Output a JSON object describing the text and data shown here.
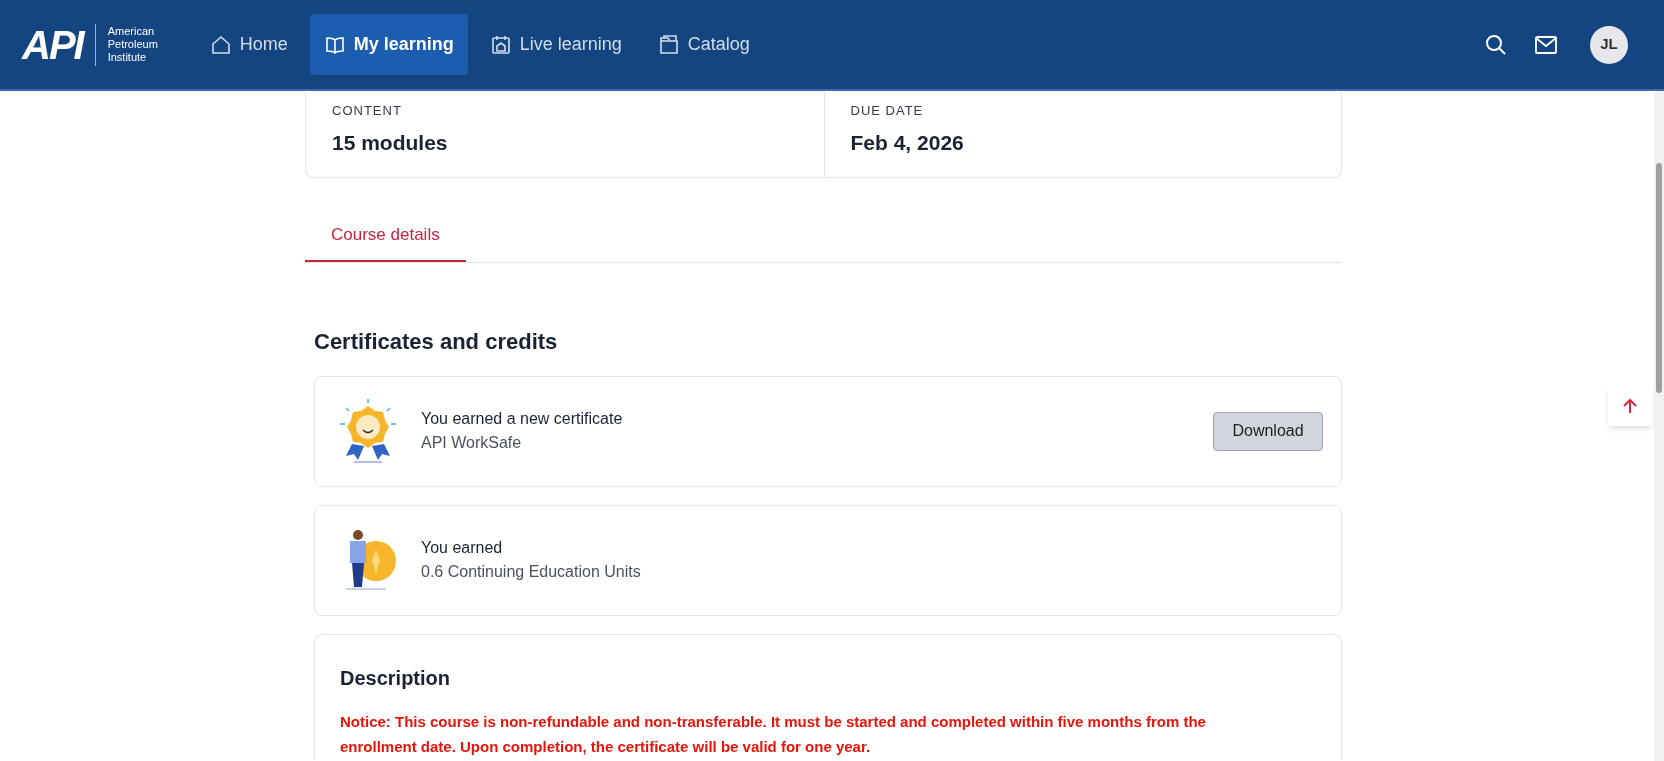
{
  "header": {
    "logo": {
      "mark": "API",
      "caption": "American Petroleum Institute"
    },
    "nav": [
      {
        "label": "Home",
        "kind": "home",
        "selected": false
      },
      {
        "label": "My learning",
        "kind": "book",
        "selected": true
      },
      {
        "label": "Live learning",
        "kind": "calendar",
        "selected": false
      },
      {
        "label": "Catalog",
        "kind": "folder",
        "selected": false
      }
    ],
    "avatar": "JL"
  },
  "stats": [
    {
      "label": "CONTENT",
      "value": "15 modules"
    },
    {
      "label": "DUE DATE",
      "value": "Feb 4, 2026"
    }
  ],
  "tabs": [
    {
      "label": "Course details",
      "selected": true
    }
  ],
  "certificates": {
    "title": "Certificates and credits",
    "items": [
      {
        "kind": "certificate",
        "title": "You earned a new certificate",
        "subtitle": "API WorkSafe",
        "button": "Download"
      },
      {
        "kind": "credits",
        "title": "You earned",
        "subtitle": "0.6 Continuing Education Units"
      }
    ]
  },
  "description": {
    "title": "Description",
    "notice": "Notice: This course is non-refundable and non-transferable. It must be started and completed within five months from the enrollment date. Upon completion, the certificate will be valid for one year."
  }
}
